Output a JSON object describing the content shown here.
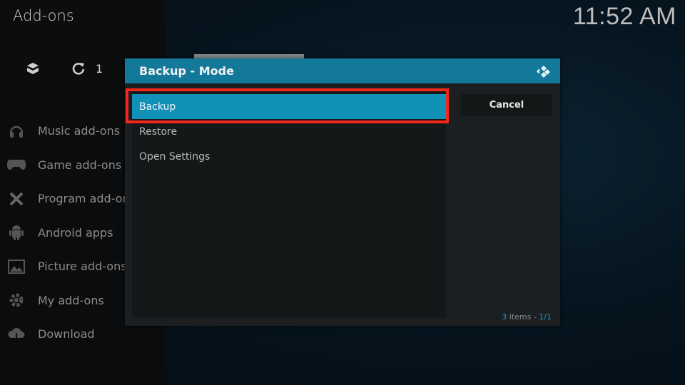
{
  "header": {
    "title": "Add-ons",
    "clock": "11:52 AM"
  },
  "toolbar": {
    "icons": [
      "box-icon",
      "refresh-icon"
    ],
    "update_count": "1"
  },
  "sidebar": {
    "items": [
      {
        "label": "Music add-ons",
        "icon": "headphones-icon"
      },
      {
        "label": "Game add-ons",
        "icon": "gamepad-icon"
      },
      {
        "label": "Program add-on",
        "icon": "tools-icon"
      },
      {
        "label": "Android apps",
        "icon": "android-icon"
      },
      {
        "label": "Picture add-ons",
        "icon": "picture-icon"
      },
      {
        "label": "My add-ons",
        "icon": "puzzle-gear-icon"
      },
      {
        "label": "Download",
        "icon": "cloud-download-icon"
      }
    ]
  },
  "dialog": {
    "title": "Backup - Mode",
    "items": [
      {
        "label": "Backup",
        "selected": true
      },
      {
        "label": "Restore",
        "selected": false
      },
      {
        "label": "Open Settings",
        "selected": false
      }
    ],
    "cancel_label": "Cancel",
    "footer": {
      "count": "3",
      "items_text": " items - ",
      "page": "1/1"
    }
  },
  "colors": {
    "accent": "#12799b",
    "selected": "#1190b8",
    "highlight": "#f3261a"
  }
}
